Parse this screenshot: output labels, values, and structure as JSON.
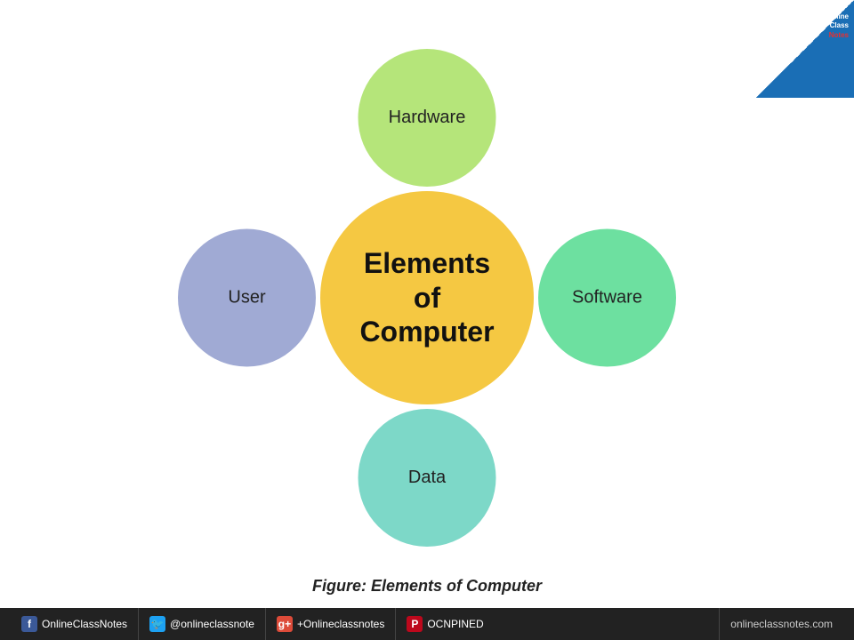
{
  "diagram": {
    "center": {
      "line1": "Elements",
      "line2": "of",
      "line3": "Computer"
    },
    "satellites": {
      "top": "Hardware",
      "right": "Software",
      "bottom": "Data",
      "left": "User"
    }
  },
  "caption": "Figure: Elements of Computer",
  "corner": {
    "line1": "Online",
    "line2": "Class",
    "line3": "Notes"
  },
  "footer": {
    "facebook_label": "OnlineClassNotes",
    "twitter_label": "@onlineclassnote",
    "googleplus_label": "+Onlineclassnotes",
    "pinterest_label": "OCNPINED",
    "website": "onlineclassnotes.com"
  }
}
